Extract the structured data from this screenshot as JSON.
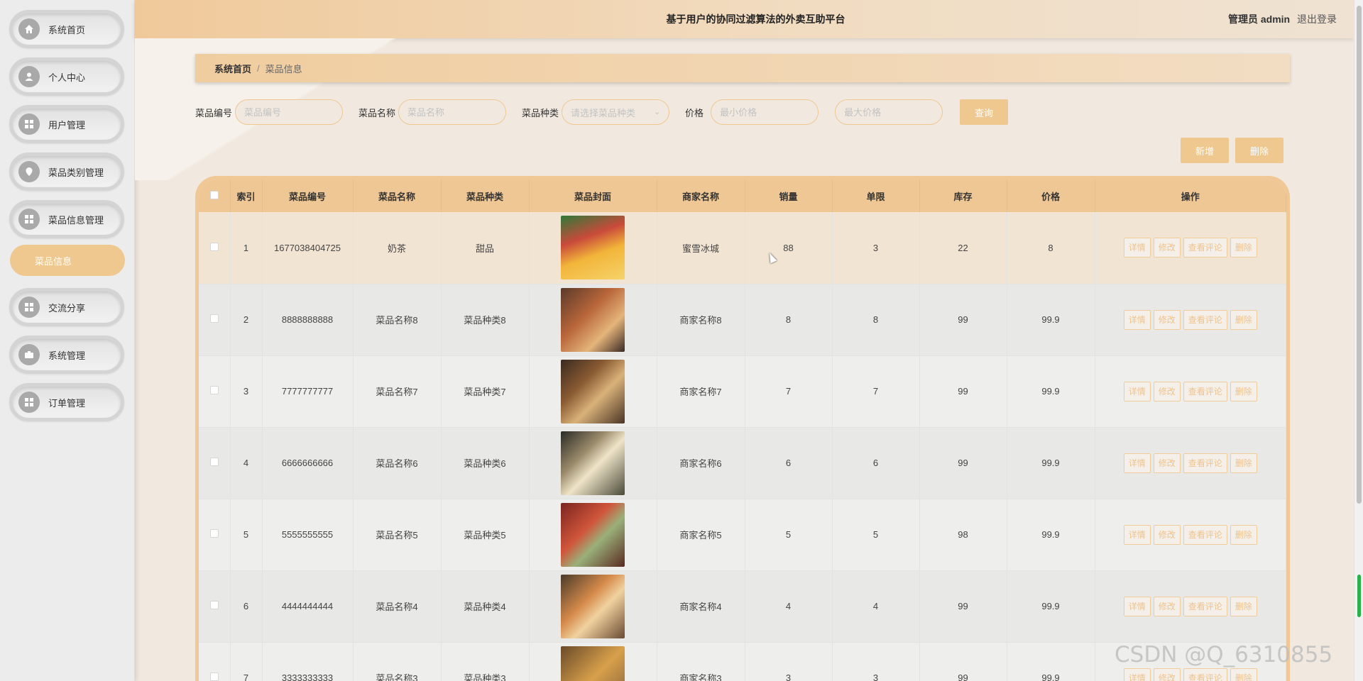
{
  "header": {
    "title": "基于用户的协同过滤算法的外卖互助平台",
    "admin_label": "管理员 admin",
    "logout": "退出登录"
  },
  "sidebar": {
    "items": [
      {
        "label": "系统首页",
        "icon": "home-icon"
      },
      {
        "label": "个人中心",
        "icon": "user-icon"
      },
      {
        "label": "用户管理",
        "icon": "grid-icon"
      },
      {
        "label": "菜品类别管理",
        "icon": "pin-icon"
      },
      {
        "label": "菜品信息管理",
        "icon": "grid-icon"
      },
      {
        "label": "交流分享",
        "icon": "grid-icon"
      },
      {
        "label": "系统管理",
        "icon": "briefcase-icon"
      },
      {
        "label": "订单管理",
        "icon": "grid-icon"
      }
    ],
    "sub_active": "菜品信息"
  },
  "breadcrumb": {
    "home": "系统首页",
    "sep": "/",
    "current": "菜品信息"
  },
  "search": {
    "code_label": "菜品编号",
    "code_placeholder": "菜品编号",
    "name_label": "菜品名称",
    "name_placeholder": "菜品名称",
    "type_label": "菜品种类",
    "type_placeholder": "请选择菜品种类",
    "price_label": "价格",
    "min_placeholder": "最小价格",
    "max_placeholder": "最大价格",
    "query": "查询"
  },
  "actions": {
    "add": "新增",
    "delete": "删除"
  },
  "table": {
    "headers": [
      "索引",
      "菜品编号",
      "菜品名称",
      "菜品种类",
      "菜品封面",
      "商家名称",
      "销量",
      "单限",
      "库存",
      "价格",
      "操作"
    ],
    "ops": [
      "详情",
      "修改",
      "查看评论",
      "删除"
    ],
    "rows": [
      {
        "idx": "1",
        "code": "1677038404725",
        "name": "奶茶",
        "type": "甜品",
        "shop": "蜜雪冰城",
        "sales": "88",
        "limit": "3",
        "stock": "22",
        "price": "8"
      },
      {
        "idx": "2",
        "code": "8888888888",
        "name": "菜品名称8",
        "type": "菜品种类8",
        "shop": "商家名称8",
        "sales": "8",
        "limit": "8",
        "stock": "99",
        "price": "99.9"
      },
      {
        "idx": "3",
        "code": "7777777777",
        "name": "菜品名称7",
        "type": "菜品种类7",
        "shop": "商家名称7",
        "sales": "7",
        "limit": "7",
        "stock": "99",
        "price": "99.9"
      },
      {
        "idx": "4",
        "code": "6666666666",
        "name": "菜品名称6",
        "type": "菜品种类6",
        "shop": "商家名称6",
        "sales": "6",
        "limit": "6",
        "stock": "99",
        "price": "99.9"
      },
      {
        "idx": "5",
        "code": "5555555555",
        "name": "菜品名称5",
        "type": "菜品种类5",
        "shop": "商家名称5",
        "sales": "5",
        "limit": "5",
        "stock": "98",
        "price": "99.9"
      },
      {
        "idx": "6",
        "code": "4444444444",
        "name": "菜品名称4",
        "type": "菜品种类4",
        "shop": "商家名称4",
        "sales": "4",
        "limit": "4",
        "stock": "99",
        "price": "99.9"
      },
      {
        "idx": "7",
        "code": "3333333333",
        "name": "菜品名称3",
        "type": "菜品种类3",
        "shop": "商家名称3",
        "sales": "3",
        "limit": "3",
        "stock": "99",
        "price": "99.9"
      }
    ]
  },
  "watermark": "CSDN @Q_6310855",
  "colors": {
    "accent": "#efc88f",
    "header_start": "#f0c99a",
    "sidebar_bg": "#ececec"
  }
}
